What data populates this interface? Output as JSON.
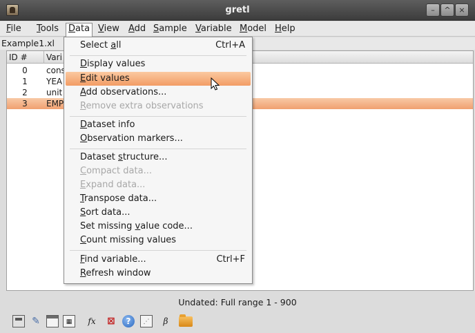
{
  "window": {
    "title": "gretl"
  },
  "menubar": {
    "items": [
      {
        "name": "menu-file",
        "pre": "",
        "mn": "F",
        "post": "ile"
      },
      {
        "name": "menu-tools",
        "pre": "",
        "mn": "T",
        "post": "ools"
      },
      {
        "name": "menu-data",
        "pre": "",
        "mn": "D",
        "post": "ata"
      },
      {
        "name": "menu-view",
        "pre": "",
        "mn": "V",
        "post": "iew"
      },
      {
        "name": "menu-add",
        "pre": "",
        "mn": "A",
        "post": "dd"
      },
      {
        "name": "menu-sample",
        "pre": "",
        "mn": "S",
        "post": "ample"
      },
      {
        "name": "menu-variable",
        "pre": "",
        "mn": "V",
        "post": "ariable"
      },
      {
        "name": "menu-model",
        "pre": "",
        "mn": "M",
        "post": "odel"
      },
      {
        "name": "menu-help",
        "pre": "",
        "mn": "H",
        "post": "elp"
      }
    ]
  },
  "dataset": {
    "filename": "Example1.xl"
  },
  "list": {
    "header": {
      "id": "ID #",
      "variable": "Vari"
    },
    "rows": [
      {
        "id": "0",
        "name": "cons"
      },
      {
        "id": "1",
        "name": "YEA"
      },
      {
        "id": "2",
        "name": "unit"
      },
      {
        "id": "3",
        "name": "EMP"
      }
    ]
  },
  "data_menu": {
    "select_all": {
      "pre": "Select ",
      "mn": "a",
      "post": "ll",
      "accel": "Ctrl+A"
    },
    "display_values": {
      "pre": "",
      "mn": "D",
      "post": "isplay values"
    },
    "edit_values": {
      "pre": "",
      "mn": "E",
      "post": "dit values"
    },
    "add_observations": {
      "pre": "",
      "mn": "A",
      "post": "dd observations..."
    },
    "remove_extra": {
      "pre": "",
      "mn": "R",
      "post": "emove extra observations"
    },
    "dataset_info": {
      "pre": "",
      "mn": "D",
      "post": "ataset info"
    },
    "observation_markers": {
      "pre": "",
      "mn": "O",
      "post": "bservation markers..."
    },
    "dataset_structure": {
      "pre": "Dataset ",
      "mn": "s",
      "post": "tructure..."
    },
    "compact_data": {
      "pre": "",
      "mn": "C",
      "post": "ompact data..."
    },
    "expand_data": {
      "pre": "",
      "mn": "E",
      "post": "xpand data..."
    },
    "transpose_data": {
      "pre": "",
      "mn": "T",
      "post": "ranspose data..."
    },
    "sort_data": {
      "pre": "",
      "mn": "S",
      "post": "ort data..."
    },
    "set_missing": {
      "pre": "Set missing ",
      "mn": "v",
      "post": "alue code..."
    },
    "count_missing": {
      "pre": "",
      "mn": "C",
      "post": "ount missing values"
    },
    "find_variable": {
      "pre": "",
      "mn": "F",
      "post": "ind variable...",
      "accel": "Ctrl+F"
    },
    "refresh_window": {
      "pre": "",
      "mn": "R",
      "post": "efresh window"
    }
  },
  "status": {
    "text": "Undated: Full range 1 - 900"
  },
  "toolbar": {
    "fx": "fx",
    "beta": "β"
  },
  "colors": {
    "highlight": "#f29c65",
    "selected_row": "#f0a070",
    "titlebar": "#3c3c3c"
  }
}
